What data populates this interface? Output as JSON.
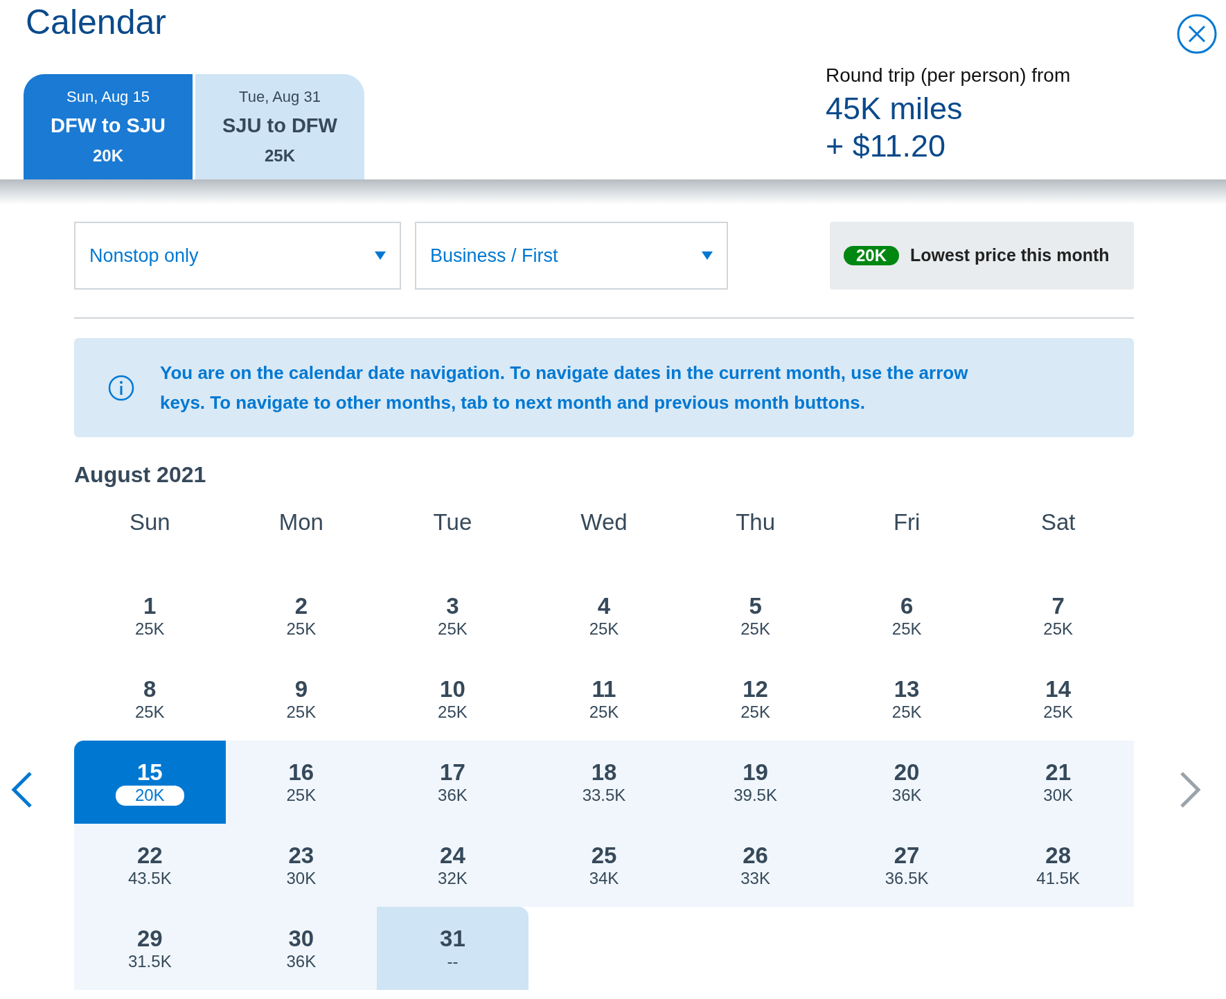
{
  "title": "Calendar",
  "legs": [
    {
      "date": "Sun, Aug 15",
      "route": "DFW to SJU",
      "price": "20K",
      "selected": true
    },
    {
      "date": "Tue, Aug 31",
      "route": "SJU to DFW",
      "price": "25K",
      "selected": false
    }
  ],
  "summary": {
    "label": "Round trip (per person) from",
    "miles": "45K miles",
    "cash": "+ $11.20"
  },
  "filters": [
    {
      "value": "Nonstop only"
    },
    {
      "value": "Business / First"
    }
  ],
  "legend": {
    "badge": "20K",
    "label": "Lowest price this month"
  },
  "info": "You are on the calendar date navigation. To navigate dates in the current month, use the arrow keys. To navigate to other months, tab to next month and previous month buttons.",
  "month": "August 2021",
  "weekdays": [
    "Sun",
    "Mon",
    "Tue",
    "Wed",
    "Thu",
    "Fri",
    "Sat"
  ],
  "days": [
    {
      "day": "1",
      "price": "25K",
      "kind": "plain"
    },
    {
      "day": "2",
      "price": "25K",
      "kind": "plain"
    },
    {
      "day": "3",
      "price": "25K",
      "kind": "plain"
    },
    {
      "day": "4",
      "price": "25K",
      "kind": "plain"
    },
    {
      "day": "5",
      "price": "25K",
      "kind": "plain"
    },
    {
      "day": "6",
      "price": "25K",
      "kind": "plain"
    },
    {
      "day": "7",
      "price": "25K",
      "kind": "plain"
    },
    {
      "day": "8",
      "price": "25K",
      "kind": "plain"
    },
    {
      "day": "9",
      "price": "25K",
      "kind": "plain"
    },
    {
      "day": "10",
      "price": "25K",
      "kind": "plain"
    },
    {
      "day": "11",
      "price": "25K",
      "kind": "plain"
    },
    {
      "day": "12",
      "price": "25K",
      "kind": "plain"
    },
    {
      "day": "13",
      "price": "25K",
      "kind": "plain"
    },
    {
      "day": "14",
      "price": "25K",
      "kind": "plain"
    },
    {
      "day": "15",
      "price": "20K",
      "kind": "depart"
    },
    {
      "day": "16",
      "price": "25K",
      "kind": "range"
    },
    {
      "day": "17",
      "price": "36K",
      "kind": "range"
    },
    {
      "day": "18",
      "price": "33.5K",
      "kind": "range"
    },
    {
      "day": "19",
      "price": "39.5K",
      "kind": "range"
    },
    {
      "day": "20",
      "price": "36K",
      "kind": "range"
    },
    {
      "day": "21",
      "price": "30K",
      "kind": "range"
    },
    {
      "day": "22",
      "price": "43.5K",
      "kind": "range"
    },
    {
      "day": "23",
      "price": "30K",
      "kind": "range"
    },
    {
      "day": "24",
      "price": "32K",
      "kind": "range"
    },
    {
      "day": "25",
      "price": "34K",
      "kind": "range"
    },
    {
      "day": "26",
      "price": "33K",
      "kind": "range"
    },
    {
      "day": "27",
      "price": "36.5K",
      "kind": "range"
    },
    {
      "day": "28",
      "price": "41.5K",
      "kind": "range"
    },
    {
      "day": "29",
      "price": "31.5K",
      "kind": "range"
    },
    {
      "day": "30",
      "price": "36K",
      "kind": "range"
    },
    {
      "day": "31",
      "price": "--",
      "kind": "return"
    }
  ]
}
